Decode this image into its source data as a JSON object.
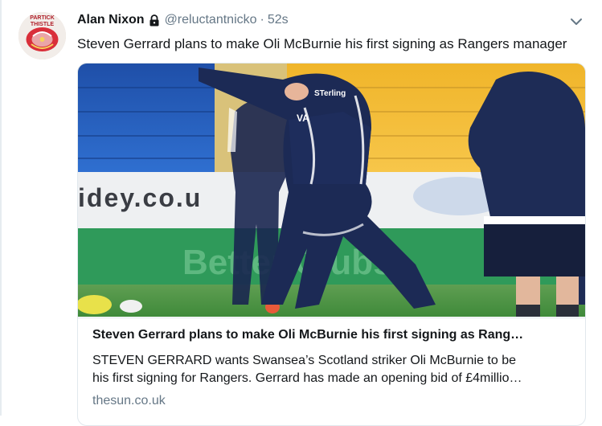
{
  "tweet": {
    "author_name": "Alan Nixon",
    "handle": "@reluctantnicko",
    "separator": "·",
    "timestamp": "52s",
    "text": "Steven Gerrard plans to make Oli McBurnie his first signing as Rangers manager",
    "avatar_text": [
      "PARTICK",
      "THISTLE"
    ]
  },
  "card": {
    "title": "Steven Gerrard plans to make Oli McBurnie his first signing as Rang…",
    "description_lines": [
      "STEVEN GERRARD wants Swansea’s Scotland striker Oli McBurnie to be",
      "his first signing for Rangers. Gerrard has made an opening bid of £4millio…"
    ],
    "domain": "thesun.co.uk",
    "photo_text": {
      "banner_left": "idey.co.u",
      "banner_center": "Better Clubs",
      "shirt_left": "VA",
      "shirt_center": "STerling"
    }
  },
  "icons": {
    "lock": "lock-icon",
    "menu": "chevron-down-icon"
  },
  "colors": {
    "text": "#14171a",
    "muted": "#657786",
    "border": "#e1e8ed",
    "navy_kit": "#1c2a55",
    "pitch": "#3f8a3a"
  }
}
